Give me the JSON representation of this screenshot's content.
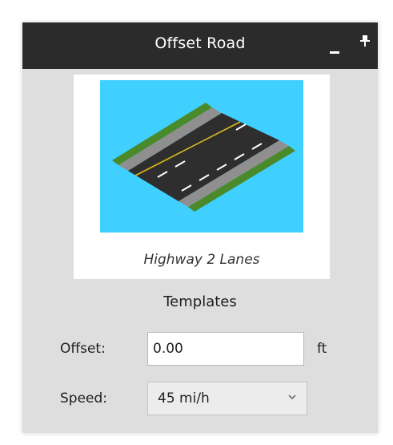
{
  "window": {
    "title": "Offset Road",
    "minimize_icon": "minimize-icon",
    "pin_icon": "pin-icon"
  },
  "template": {
    "name": "Highway 2 Lanes",
    "section_label": "Templates",
    "colors": {
      "sky": "#3fd0ff",
      "grass": "#4a8a2a",
      "shoulder": "#8f8f8f",
      "asphalt": "#2e2e2e",
      "center_line": "#e0b81c",
      "lane_line": "#ffffff"
    }
  },
  "offset": {
    "label": "Offset:",
    "value": "0.00",
    "unit": "ft"
  },
  "speed": {
    "label": "Speed:",
    "value": "45 mi/h",
    "icon": "chevron-down-icon"
  }
}
